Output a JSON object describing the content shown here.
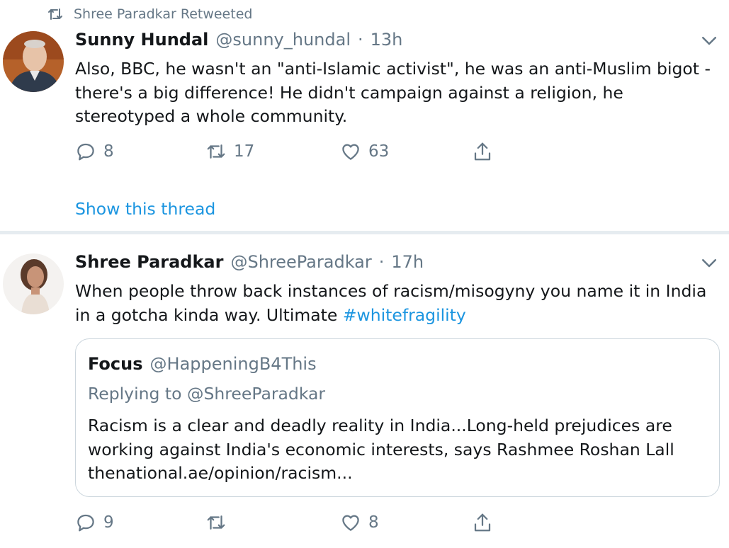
{
  "retweet_line": {
    "text": "Shree Paradkar Retweeted",
    "icon": "retweet-icon"
  },
  "tweets": [
    {
      "author_name": "Sunny Hundal",
      "author_handle": "@sunny_hundal",
      "separator": "·",
      "time": "13h",
      "text": "Also, BBC, he wasn't an \"anti-Islamic activist\", he was an anti-Muslim bigot - there's a big difference! He didn't campaign against a religion, he stereotyped a whole community.",
      "replies": "8",
      "retweets": "17",
      "likes": "63",
      "show_thread": "Show this thread"
    },
    {
      "author_name": "Shree Paradkar",
      "author_handle": "@ShreeParadkar",
      "separator": "·",
      "time": "17h",
      "text": "When people throw back instances of racism/misogyny you name it in India in a gotcha kinda way. Ultimate",
      "hashtag": "#whitefragility",
      "quoted": {
        "author_name": "Focus",
        "author_handle": "@HappeningB4This",
        "replying_to": "Replying to @ShreeParadkar",
        "text": "Racism is a clear and deadly reality in India...Long-held prejudices are working against India's economic interests, says Rashmee Roshan Lall thenational.ae/opinion/racism..."
      },
      "replies": "9",
      "retweets": "",
      "likes": "8"
    }
  ],
  "colors": {
    "accent": "#1b95e0",
    "muted": "#657786",
    "divider": "#e6ecf0",
    "border": "#ccd6dd"
  }
}
